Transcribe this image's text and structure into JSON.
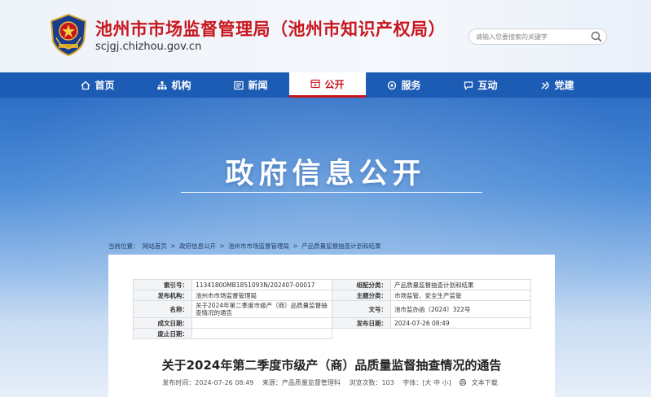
{
  "header": {
    "title": "池州市市场监督管理局（池州市知识产权局）",
    "domain": "scjgj.chizhou.gov.cn",
    "search_placeholder": "请输入您要搜索的关键字"
  },
  "nav": {
    "items": [
      {
        "label": "首页",
        "icon": "home-icon"
      },
      {
        "label": "机构",
        "icon": "org-icon"
      },
      {
        "label": "新闻",
        "icon": "news-icon"
      },
      {
        "label": "公开",
        "icon": "open-icon",
        "active": true
      },
      {
        "label": "服务",
        "icon": "service-icon"
      },
      {
        "label": "互动",
        "icon": "chat-icon"
      },
      {
        "label": "党建",
        "icon": "party-icon"
      }
    ]
  },
  "banner": {
    "title": "政府信息公开"
  },
  "breadcrumb": {
    "prefix": "当前位置：",
    "items": [
      "网站首页",
      "政府信息公开",
      "池州市市场监督管理局",
      "产品质量监督抽查计划和结果"
    ],
    "separator": ">"
  },
  "meta": {
    "index_label": "索引号：",
    "index_value": "11341800MB1851093N/202407-00017",
    "category_label": "组配分类：",
    "category_value": "产品质量监督抽查计划和结果",
    "publisher_label": "发布机构：",
    "publisher_value": "池州市市场监督管理局",
    "topic_label": "主题分类：",
    "topic_value": "市场监管、安全生产监管",
    "name_label": "名称：",
    "name_value": "关于2024年第二季度市级产（商）品质量监督抽查情况的通告",
    "docno_label": "文号：",
    "docno_value": "池市监办函〔2024〕322号",
    "created_label": "成文日期：",
    "created_value": "",
    "published_label": "发布日期：",
    "published_value": "2024-07-26 08:49",
    "abolished_label": "废止日期：",
    "abolished_value": ""
  },
  "article": {
    "title": "关于2024年第二季度市级产（商）品质量监督抽查情况的通告",
    "pubtime": "发布时间：2024-07-26 08:49",
    "source": "来源：产品质量监督管理科",
    "views": "浏览次数：103",
    "fontsize": "字体：[大 中 小]",
    "download": "文本下载"
  },
  "colors": {
    "brand_red": "#c8161d",
    "nav_blue": "#1d5cb4"
  }
}
